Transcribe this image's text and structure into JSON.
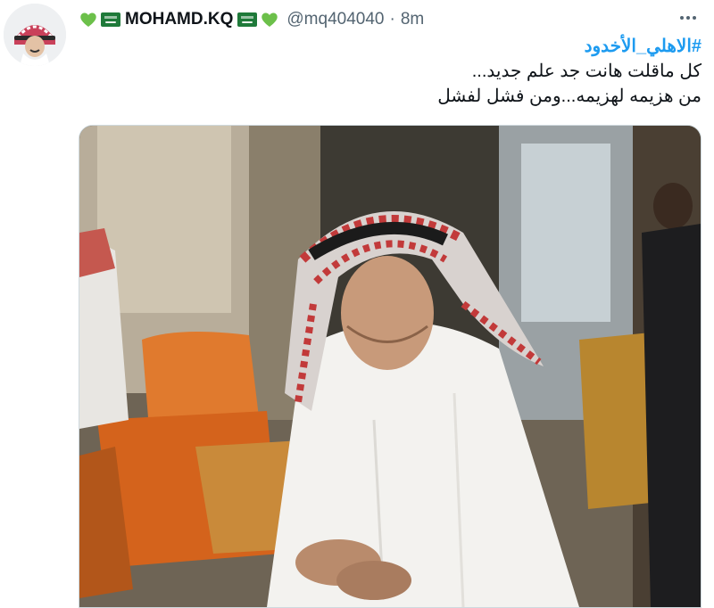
{
  "tweet": {
    "author": {
      "display_name": "MOHAMD.KQ",
      "handle": "@mq404040",
      "separator": "·",
      "time": "8m",
      "avatar": "avatar-image",
      "decorations": [
        "green-heart-icon",
        "saudi-flag-icon",
        "saudi-flag-icon",
        "green-heart-icon"
      ]
    },
    "hashtag": "#الاهلي_الأخدود",
    "lines": [
      "كل ماقلت هانت جد علم جديد...",
      "من هزيمه لهزيمه...ومن فشل لفشل"
    ],
    "menu_icon": "more-options-icon",
    "media": {
      "type": "photo"
    }
  },
  "colors": {
    "accent": "#1d9bf0",
    "text": "#0f1419",
    "secondary": "#536471",
    "heart": "#6cc04a",
    "flag": "#1f7a3a"
  }
}
